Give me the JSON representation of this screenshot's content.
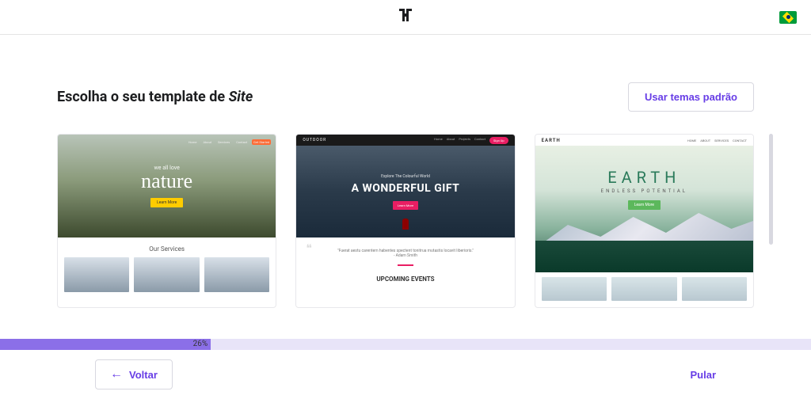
{
  "header": {
    "logo": "H"
  },
  "title": {
    "prefix": "Escolha o seu template de ",
    "emphasis": "Site"
  },
  "buttons": {
    "default_themes": "Usar temas padrão",
    "back": "Voltar",
    "skip": "Pular"
  },
  "progress": {
    "percent": 26,
    "label": "26%"
  },
  "templates": [
    {
      "id": "nature",
      "nav_items": [
        "Home",
        "About",
        "Services",
        "Contact"
      ],
      "nav_cta": "Get Started",
      "kicker": "we all love",
      "headline": "nature",
      "cta": "Learn More",
      "section_title": "Our Services"
    },
    {
      "id": "outdoor",
      "brand": "OUTDOOR",
      "nav_items": [
        "Home",
        "About",
        "Projects",
        "Contact"
      ],
      "nav_cta": "Sign Up",
      "kicker": "Explore The Colourful World",
      "headline": "A WONDERFUL GIFT",
      "cta": "Learn More",
      "quote": "\"Fuerat aestu carentem habentes spectent tonitrua mutastis locavit liberioris.\"",
      "quote_author": "- Adam Smith",
      "section_title": "UPCOMING EVENTS"
    },
    {
      "id": "earth",
      "brand": "EARTH",
      "nav_items": [
        "HOME",
        "ABOUT",
        "SERVICES",
        "CONTACT"
      ],
      "headline": "EARTH",
      "subhead": "ENDLESS POTENTIAL",
      "cta": "Learn More"
    }
  ]
}
